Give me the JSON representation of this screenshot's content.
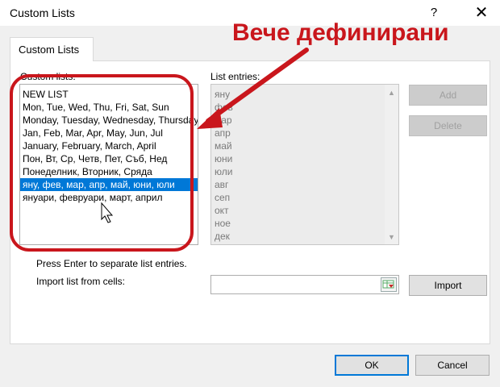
{
  "window": {
    "title": "Custom Lists",
    "help_symbol": "?",
    "close_symbol": "✕"
  },
  "tab": {
    "label": "Custom Lists"
  },
  "custom_lists": {
    "label": "Custom lists:",
    "items": [
      "NEW LIST",
      "Mon, Tue, Wed, Thu, Fri, Sat, Sun",
      "Monday, Tuesday, Wednesday, Thursday",
      "Jan, Feb, Mar, Apr, May, Jun, Jul",
      "January, February, March, April",
      "Пон, Вт, Ср, Четв, Пет, Съб, Нед",
      "Понеделник, Вторник, Сряда",
      "яну, фев, мар, апр, май, юни, юли",
      "януари, февруари, март, април"
    ],
    "selected_index": 7
  },
  "list_entries": {
    "label": "List entries:",
    "items": [
      "яну",
      "фев",
      "мар",
      "апр",
      "май",
      "юни",
      "юли",
      "авг",
      "сеп",
      "окт",
      "ное",
      "дек"
    ]
  },
  "buttons": {
    "add": "Add",
    "delete": "Delete",
    "import": "Import",
    "ok": "OK",
    "cancel": "Cancel"
  },
  "hint_text": "Press Enter to separate list entries.",
  "import_label": "Import list from cells:",
  "import_value": "",
  "annotation": {
    "text": "Вече дефинирани",
    "color": "#c9161c"
  },
  "accent_color": "#0078d7"
}
